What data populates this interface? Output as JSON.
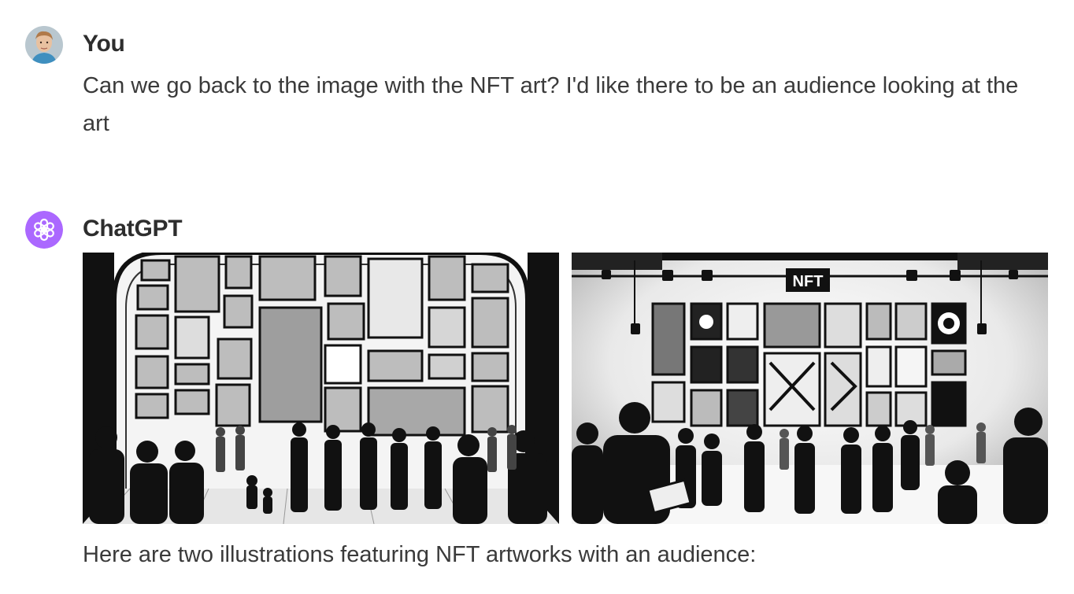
{
  "conversation": {
    "user_message": {
      "author": "You",
      "avatar_icon": "user-photo-avatar",
      "text": "Can we go back to the image with the NFT art? I'd like there to be an audience looking at the art"
    },
    "assistant_message": {
      "author": "ChatGPT",
      "avatar_icon": "openai-logo-icon",
      "avatar_color": "#ab68ff",
      "images": [
        {
          "label": ""
        },
        {
          "label": "NFT"
        }
      ],
      "caption": "Here are two illustrations featuring NFT artworks with an audience:"
    }
  }
}
